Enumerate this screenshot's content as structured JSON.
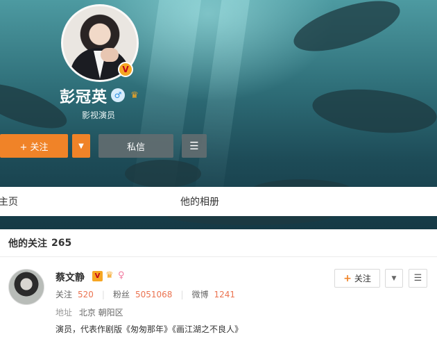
{
  "profile": {
    "name": "彭冠英",
    "verified_badge": "V",
    "gender_icon": "♂",
    "title": "影视演员"
  },
  "actions": {
    "follow_label": "+ 关注",
    "follow_dropdown_icon": "▼",
    "message_label": "私信",
    "menu_icon": "☰"
  },
  "tabs": [
    {
      "label": "主页"
    },
    {
      "label": "他的相册"
    }
  ],
  "following": {
    "heading": "他的关注",
    "count": "265",
    "items": [
      {
        "name": "蔡文静",
        "verified_badge": "V",
        "stats": [
          {
            "label": "关注",
            "value": "520"
          },
          {
            "label": "粉丝",
            "value": "5051068"
          },
          {
            "label": "微博",
            "value": "1241"
          }
        ],
        "address_label": "地址",
        "address": "北京 朝阳区",
        "bio": "演员，代表作剧版《匆匆那年》《画江湖之不良人》",
        "follow_label": "关注",
        "dropdown_icon": "▼",
        "menu_icon": "☰"
      }
    ]
  },
  "colors": {
    "accent_orange": "#f08328",
    "number_orange": "#eb7350",
    "cover_teal": "#2f6f79"
  }
}
